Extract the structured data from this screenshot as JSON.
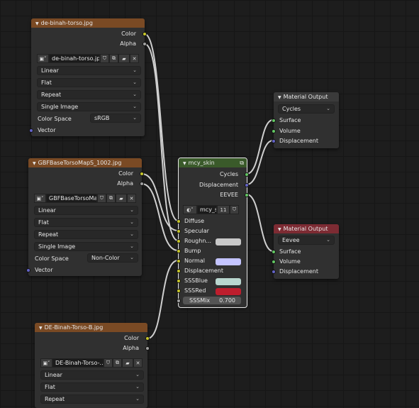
{
  "colors": {
    "tex_header": "#7a4a24",
    "group_header": "#3a5a2a",
    "output_header": "#7d2b33",
    "socket_color": "#c7c729",
    "socket_float": "#a1a1a1",
    "socket_vector": "#6363c7",
    "socket_shader": "#63c763"
  },
  "node1": {
    "title": "de-binah-torso.jpg",
    "out_color": "Color",
    "out_alpha": "Alpha",
    "image_name": "de-binah-torso.jpg",
    "interp": "Linear",
    "projection": "Flat",
    "extension": "Repeat",
    "source": "Single Image",
    "colorspace_label": "Color Space",
    "colorspace": "sRGB",
    "in_vector": "Vector"
  },
  "node2": {
    "title": "GBFBaseTorsoMapS_1002.jpg",
    "out_color": "Color",
    "out_alpha": "Alpha",
    "image_name": "GBFBaseTorsoMa...",
    "interp": "Linear",
    "projection": "Flat",
    "extension": "Repeat",
    "source": "Single Image",
    "colorspace_label": "Color Space",
    "colorspace": "Non-Color",
    "in_vector": "Vector"
  },
  "node3": {
    "title": "DE-Binah-Torso-B.jpg",
    "out_color": "Color",
    "out_alpha": "Alpha",
    "image_name": "DE-Binah-Torso-...",
    "interp": "Linear",
    "projection": "Flat",
    "extension": "Repeat"
  },
  "group": {
    "title": "mcy_skin",
    "out_cycles": "Cycles",
    "out_displacement": "Displacement",
    "out_eevee": "EEVEE",
    "tree_name": "mcy_s",
    "users": "11",
    "inputs": [
      "Diffuse",
      "Specular",
      "Roughn...",
      "Bump",
      "Normal",
      "Displacement",
      "SSSBlue",
      "SSSRed"
    ],
    "sssmix_label": "SSSMix",
    "sssmix_value": "0.700",
    "roughness_color": "#c8c8c8",
    "normal_color": "#c4c4ff",
    "sssblue_color": "#b9d6cf",
    "sssred_color": "#be1e2d"
  },
  "out1": {
    "title": "Material Output",
    "target": "Cycles",
    "in_surface": "Surface",
    "in_volume": "Volume",
    "in_displacement": "Displacement"
  },
  "out2": {
    "title": "Material Output",
    "target": "Eevee",
    "in_surface": "Surface",
    "in_volume": "Volume",
    "in_displacement": "Displacement"
  }
}
